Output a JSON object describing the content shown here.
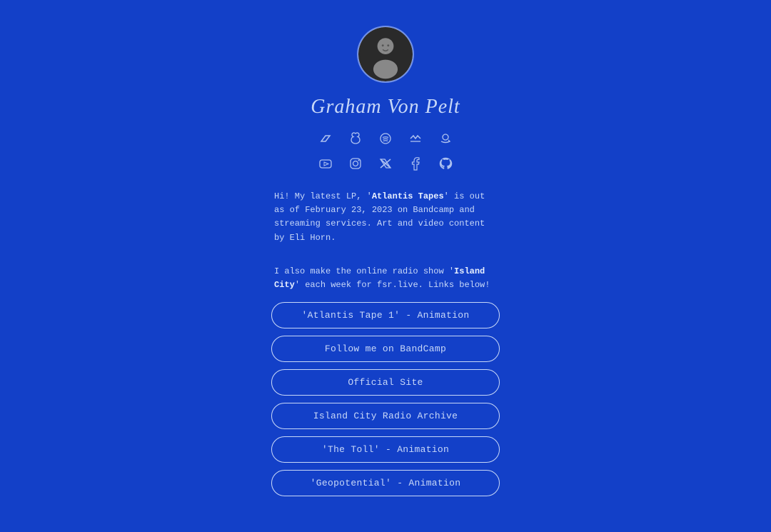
{
  "profile": {
    "name": "Graham Von Pelt",
    "avatar_alt": "Profile photo"
  },
  "icons_row1": [
    {
      "name": "bandcamp-icon",
      "glyph": "⬡",
      "label": "Bandcamp"
    },
    {
      "name": "apple-music-icon",
      "glyph": "🍎",
      "label": "Apple Music"
    },
    {
      "name": "spotify-icon",
      "glyph": "🎵",
      "label": "Spotify"
    },
    {
      "name": "last-fm-icon",
      "glyph": "✦",
      "label": "Last.fm"
    },
    {
      "name": "amazon-icon",
      "glyph": "∂",
      "label": "Amazon"
    }
  ],
  "icons_row2": [
    {
      "name": "youtube-icon",
      "glyph": "▶",
      "label": "YouTube"
    },
    {
      "name": "instagram-icon",
      "glyph": "◎",
      "label": "Instagram"
    },
    {
      "name": "twitter-icon",
      "glyph": "𝕏",
      "label": "Twitter"
    },
    {
      "name": "facebook-icon",
      "glyph": "ƒ",
      "label": "Facebook"
    },
    {
      "name": "github-icon",
      "glyph": "⌂",
      "label": "GitHub"
    }
  ],
  "bio": {
    "paragraph1_before": "Hi! My latest LP, '",
    "paragraph1_bold": "Atlantis Tapes",
    "paragraph1_after": "' is out as of February 23, 2023 on Bandcamp and streaming services. Art and video content by Eli Horn.",
    "paragraph2_before": "I also make the online radio show '",
    "paragraph2_bold": "Island City",
    "paragraph2_after": "' each week for fsr.live. Links below!"
  },
  "buttons": [
    {
      "id": "btn-atlantis",
      "label": "'Atlantis Tape 1' - Animation"
    },
    {
      "id": "btn-bandcamp",
      "label": "Follow me on BandCamp"
    },
    {
      "id": "btn-official",
      "label": "Official Site"
    },
    {
      "id": "btn-radio",
      "label": "Island City Radio Archive"
    },
    {
      "id": "btn-toll",
      "label": "'The Toll' - Animation"
    },
    {
      "id": "btn-geopotential",
      "label": "'Geopotential' - Animation"
    }
  ]
}
